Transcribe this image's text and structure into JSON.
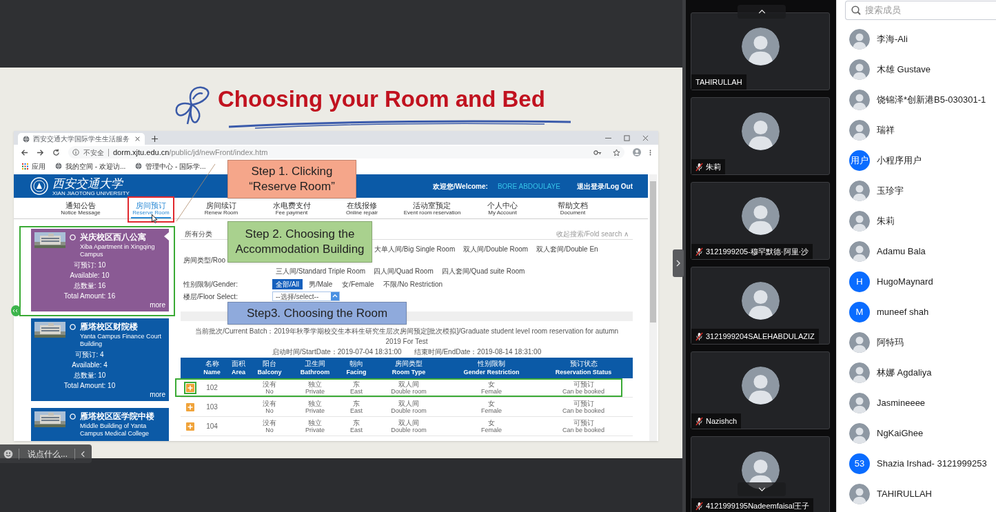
{
  "slide": {
    "title": "Choosing your Room and Bed",
    "browser": {
      "tab_title": "西安交通大学国际学生生活服务",
      "security_label": "不安全",
      "url_host": "dorm.xjtu.edu.cn",
      "url_path": "/public/jd/newFront/index.htm",
      "bookmarks": [
        {
          "label": "应用",
          "kind": "apps"
        },
        {
          "label": "我的空间 - 欢迎访...",
          "kind": "page"
        },
        {
          "label": "管理中心 - 国际学...",
          "kind": "page"
        }
      ]
    },
    "site": {
      "logo_text": "西安交通大学",
      "logo_subtitle": "XIAN JIAOTONG UNIVERSITY",
      "welcome_label": "欢迎您/Welcome:",
      "user_name": "BORE ABDOULAYE",
      "logout": "退出登录/Log Out",
      "nav": [
        {
          "zh": "通知公告",
          "en": "Notice Message",
          "selected": false,
          "highlighted": false
        },
        {
          "zh": "房间预订",
          "en": "Reserve Room",
          "selected": true,
          "highlighted": true
        },
        {
          "zh": "房间续订",
          "en": "Renew Room",
          "selected": false,
          "highlighted": false
        },
        {
          "zh": "水电费支付",
          "en": "Fee payment",
          "selected": false,
          "highlighted": false
        },
        {
          "zh": "在线报修",
          "en": "Online repair",
          "selected": false,
          "highlighted": false
        },
        {
          "zh": "活动室预定",
          "en": "Event room reservation",
          "selected": false,
          "highlighted": false
        },
        {
          "zh": "个人中心",
          "en": "My Account",
          "selected": false,
          "highlighted": false
        },
        {
          "zh": "帮助文档",
          "en": "Document",
          "selected": false,
          "highlighted": false
        }
      ],
      "buildings": [
        {
          "name_zh": "兴庆校区西八公寓",
          "name_en": "Xiba Apartment in Xingqing Campus",
          "available_zh": "可预订: 10",
          "available_en": "Available: 10",
          "total_zh": "总数量: 16",
          "total_en": "Total Amount: 16",
          "more": "more",
          "selected": true,
          "highlighted": true
        },
        {
          "name_zh": "雁塔校区财院楼",
          "name_en": "Yanta Campus Finance Court Building",
          "available_zh": "可预订: 4",
          "available_en": "Available: 4",
          "total_zh": "总数量: 10",
          "total_en": "Total Amount: 10",
          "more": "more",
          "selected": false,
          "highlighted": false
        },
        {
          "name_zh": "雁塔校区医学院中楼",
          "name_en": "Middle Building of Yanta Campus Medical College",
          "selected": false,
          "highlighted": false
        }
      ],
      "filter": {
        "category_label": "所有分类",
        "fold": "收起搜索/Fold search ∧",
        "room_type_label": "房间类型/Roo",
        "room_types_row_1": [
          "大单人间/Big Single Room",
          "双人间/Double Room",
          "双人套间/Double En"
        ],
        "room_types_row_2": [
          "三人间/Standard Triple Room",
          "四人间/Quad Room",
          "四人套间/Quad suite Room"
        ],
        "gender_label": "性别限制/Gender:",
        "genders": [
          {
            "label": "全部/All",
            "selected": true
          },
          {
            "label": "男/Male",
            "selected": false
          },
          {
            "label": "女/Female",
            "selected": false
          },
          {
            "label": "不限/No Restriction",
            "selected": false
          }
        ],
        "floor_label": "楼层/Floor Select:",
        "floor_select": "--选择/select--"
      },
      "batch": {
        "text": "当前批次/Current Batch：2019年秋季学期校交生本科生研究生层次房间预定[批次模拟]/Graduate student level room reservation for autumn 2019 For Test",
        "start": "启动时间/StartDate：2019-07-04 18:31:00",
        "end": "结束时间/EndDate：2019-08-14 18:31:00"
      },
      "table": {
        "columns": [
          {
            "zh": "名称",
            "en": "Name"
          },
          {
            "zh": "面积",
            "en": "Area"
          },
          {
            "zh": "阳台",
            "en": "Balcony"
          },
          {
            "zh": "卫生间",
            "en": "Bathroom"
          },
          {
            "zh": "朝向",
            "en": "Facing"
          },
          {
            "zh": "房间类型",
            "en": "Room Type"
          },
          {
            "zh": "性别限制",
            "en": "Gender Restriction"
          },
          {
            "zh": "预订状态",
            "en": "Reservation Status"
          }
        ],
        "rows": [
          {
            "highlighted": true,
            "cells": [
              {
                "text": "102"
              },
              {
                "text": ""
              },
              {
                "zh": "没有",
                "en": "No"
              },
              {
                "zh": "独立",
                "en": "Private"
              },
              {
                "zh": "东",
                "en": "East"
              },
              {
                "zh": "双人间",
                "en": "Double room"
              },
              {
                "zh": "女",
                "en": "Female"
              },
              {
                "zh": "可预订",
                "en": "Can be booked"
              }
            ]
          },
          {
            "highlighted": false,
            "cells": [
              {
                "text": "103"
              },
              {
                "text": ""
              },
              {
                "zh": "没有",
                "en": "No"
              },
              {
                "zh": "独立",
                "en": "Private"
              },
              {
                "zh": "东",
                "en": "East"
              },
              {
                "zh": "双人间",
                "en": "Double room"
              },
              {
                "zh": "女",
                "en": "Female"
              },
              {
                "zh": "可预订",
                "en": "Can be booked"
              }
            ]
          },
          {
            "highlighted": false,
            "cells": [
              {
                "text": "104"
              },
              {
                "text": ""
              },
              {
                "zh": "没有",
                "en": "No"
              },
              {
                "zh": "独立",
                "en": "Private"
              },
              {
                "zh": "东",
                "en": "East"
              },
              {
                "zh": "双人间",
                "en": "Double room"
              },
              {
                "zh": "女",
                "en": "Female"
              },
              {
                "zh": "可预订",
                "en": "Can be booked"
              }
            ]
          }
        ]
      }
    },
    "callouts": [
      {
        "lines": [
          "Step 1. Clicking",
          "“Reserve Room”"
        ],
        "color": "#f5a68a"
      },
      {
        "lines": [
          "Step 2. Choosing the",
          "Accommodation Building"
        ],
        "color": "#a9d18e"
      },
      {
        "lines": [
          "Step3. Choosing the Room"
        ],
        "color": "#8faadc"
      }
    ]
  },
  "chat_input": {
    "placeholder": "说点什么..."
  },
  "video_tiles": [
    {
      "name": "TAHIRULLAH",
      "muted": false
    },
    {
      "name": "朱莉",
      "muted": true
    },
    {
      "name": "3121999205-穆罕默德·阿里·沙",
      "muted": true
    },
    {
      "name": "3121999204SALEHABDULAZIZ",
      "muted": true
    },
    {
      "name": "Nazishch",
      "muted": true
    },
    {
      "name": "4121999195Nadeemfaisal王子",
      "muted": true
    }
  ],
  "members": {
    "search_placeholder": "搜索成员",
    "list": [
      {
        "name": "李海-Ali"
      },
      {
        "name": "木雄 Gustave"
      },
      {
        "name": "饶锦泽*创新港B5-030301-1"
      },
      {
        "name": "瑞祥"
      },
      {
        "name": "小程序用户",
        "kind": "initials",
        "initials": "用户"
      },
      {
        "name": "玉珍宇"
      },
      {
        "name": "朱莉"
      },
      {
        "name": "Adamu Bala"
      },
      {
        "name": "HugoMaynard",
        "kind": "initials",
        "initials": "H"
      },
      {
        "name": "muneef shah",
        "kind": "initials",
        "initials": "M"
      },
      {
        "name": "阿特玛"
      },
      {
        "name": "林娜 Agdaliya"
      },
      {
        "name": "Jasmineeee"
      },
      {
        "name": "NgKaiGhee"
      },
      {
        "name": "Shazia Irshad- 3121999253",
        "kind": "initials",
        "initials": "53"
      },
      {
        "name": "TAHIRULLAH"
      }
    ]
  }
}
